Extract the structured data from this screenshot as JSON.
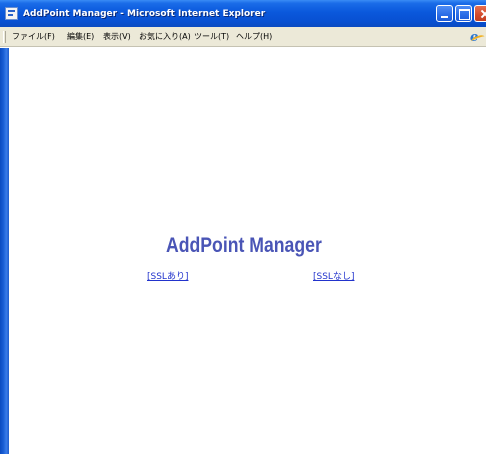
{
  "window": {
    "title": "AddPoint Manager - Microsoft Internet Explorer",
    "controls": [
      "minimize",
      "maximize",
      "close"
    ]
  },
  "menubar": {
    "items": [
      {
        "label": "ファイル(F)"
      },
      {
        "label": "編集(E)"
      },
      {
        "label": "表示(V)"
      },
      {
        "label": "お気に入り(A)"
      },
      {
        "label": "ツール(T)"
      },
      {
        "label": "ヘルプ(H)"
      }
    ],
    "logo_icon": "ie-logo-icon"
  },
  "main": {
    "logo_text": "AddPoint Manager",
    "links": {
      "ssl": "[SSLあり]",
      "no_ssl": "[SSLなし]"
    }
  },
  "colors": {
    "titlebar": "#0a58dc",
    "menubar": "#ece9d8",
    "logo": "#4a55b6",
    "link": "#2233cc",
    "close_button": "#d24a2c"
  }
}
